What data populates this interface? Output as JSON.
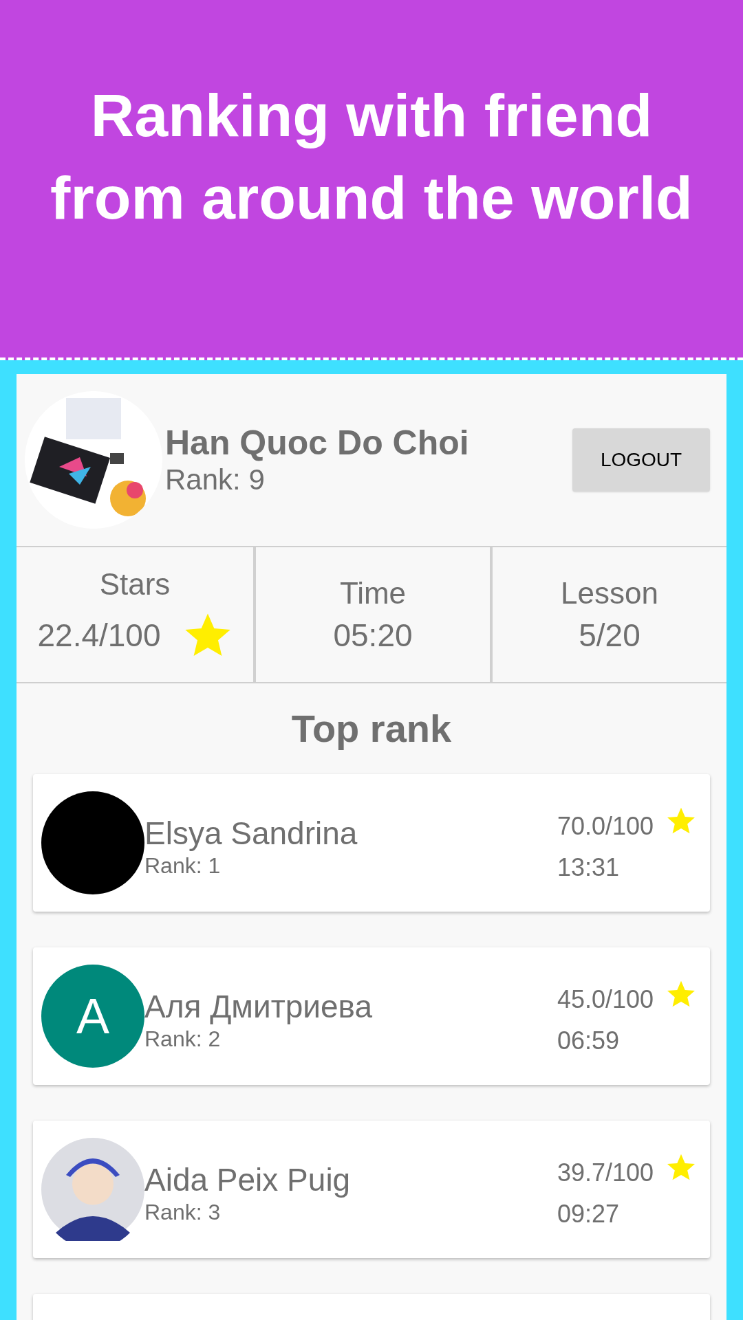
{
  "banner": {
    "title": "Ranking with friend from around the world"
  },
  "profile": {
    "name": "Han Quoc Do Choi",
    "rank": "Rank: 9",
    "button": "LOGOUT"
  },
  "stats": [
    {
      "kind": "stars",
      "label": "Stars",
      "value": "22.4/100"
    },
    {
      "kind": "plain",
      "label": "Time",
      "value": "05:20"
    },
    {
      "kind": "plain",
      "label": "Lesson",
      "value": "5/20"
    }
  ],
  "section_title": "Top rank",
  "players": [
    {
      "name": "Elsya Sandrina",
      "rank": "Rank: 1",
      "score": "70.0/100",
      "time": "13:31",
      "avatar": {
        "kind": "plain",
        "color": "#000000"
      }
    },
    {
      "name": "Аля Дмитриева",
      "rank": "Rank: 2",
      "score": "45.0/100",
      "time": "06:59",
      "avatar": {
        "kind": "letter",
        "letter": "A",
        "color": "#00897b"
      }
    },
    {
      "name": "Aida Peix Puig",
      "rank": "Rank: 3",
      "score": "39.7/100",
      "time": "09:27",
      "avatar": {
        "kind": "figure"
      }
    }
  ]
}
